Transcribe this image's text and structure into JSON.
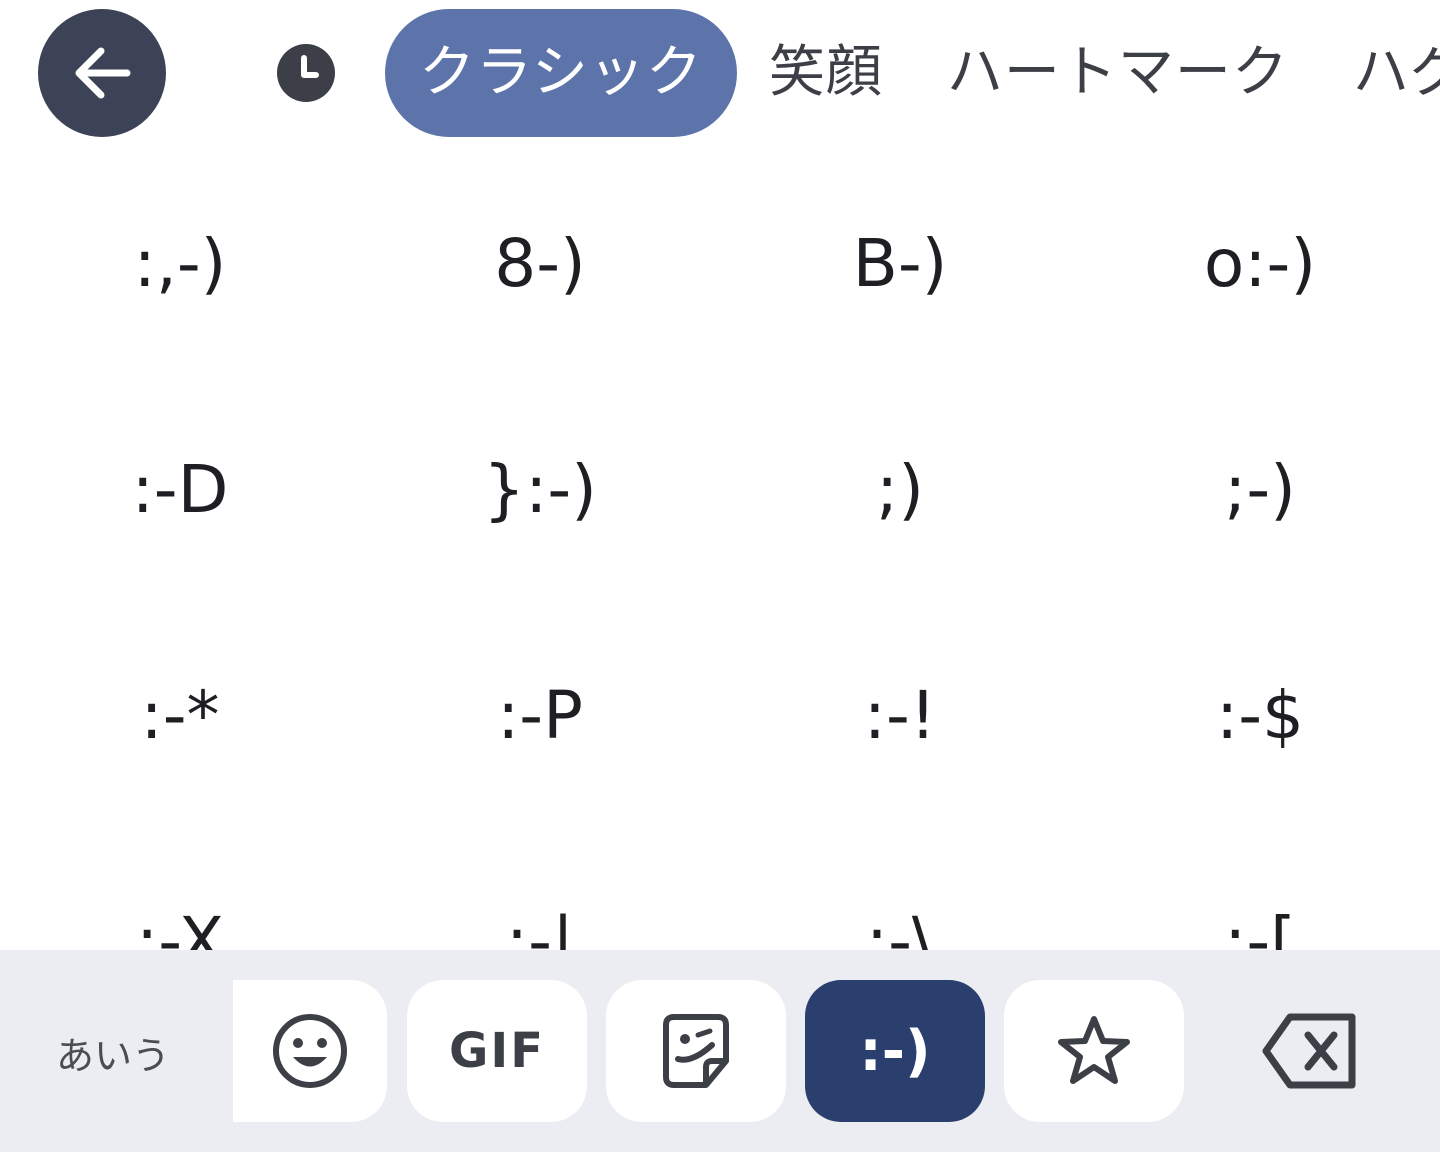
{
  "header": {
    "back_icon": "arrow-left-icon",
    "recent_icon": "clock-icon",
    "tabs": [
      {
        "label": "クラシック",
        "active": true
      },
      {
        "label": "笑顔",
        "active": false
      },
      {
        "label": "ハートマーク",
        "active": false
      },
      {
        "label": "ハグ",
        "active": false
      }
    ]
  },
  "emoticons": [
    ":,-)",
    "8-)",
    "B-)",
    "o:-)",
    ":-D",
    "}:-)",
    ";)",
    ";-)",
    ":-*",
    ":-P",
    ":-!",
    ":-$",
    ":-X",
    ":-|",
    ":-\\",
    ":-["
  ],
  "toolbar": {
    "ime_label": "あいう",
    "emoji_icon": "smiley-face-icon",
    "gif_label": "GIF",
    "sticker_icon": "sticker-icon",
    "emoticon_label": ":-)",
    "favorites_icon": "star-icon",
    "backspace_icon": "backspace-icon"
  },
  "colors": {
    "active_tab_bg": "#5d74aa",
    "back_button_bg": "#3c4356",
    "active_tool_bg": "#2b3f6e",
    "toolbar_bg": "#ececf3"
  }
}
